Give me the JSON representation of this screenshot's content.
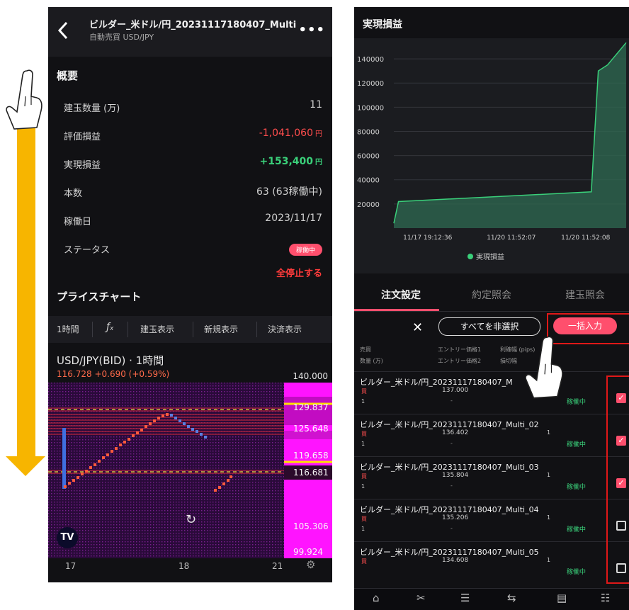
{
  "left_screen": {
    "header": {
      "title": "ビルダー_米ドル/円_20231117180407_Multi",
      "subtitle": "自動売買 USD/JPY",
      "back_icon": "chevron-left-icon",
      "more_icon": "more-dots-icon"
    },
    "summary": {
      "title": "概要",
      "rows": [
        {
          "label": "建玉数量 (万)",
          "value": "11",
          "unit": ""
        },
        {
          "label": "評価損益",
          "value": "-1,041,060",
          "unit": "円"
        },
        {
          "label": "実現損益",
          "value": "+153,400",
          "unit": "円"
        },
        {
          "label": "本数",
          "value": "63 (63稼働中)",
          "unit": ""
        },
        {
          "label": "稼働日",
          "value": "2023/11/17",
          "unit": ""
        },
        {
          "label": "ステータス",
          "value": "",
          "unit": ""
        }
      ],
      "status_badge": "稼働中",
      "stop_all": "全停止する"
    },
    "price_chart": {
      "title": "プライスチャート",
      "toolbar": [
        "1時間",
        "fx",
        "建玉表示",
        "新規表示",
        "決済表示"
      ],
      "symbol": "USD/JPY(BID) · 1時間",
      "change": "116.728 +0.690 (+0.59%)",
      "price_labels": [
        "140.000",
        "129.837",
        "125.648",
        "119.658",
        "116.681",
        "105.306",
        "99.924"
      ],
      "x_labels": [
        "17",
        "18",
        "21"
      ],
      "logo": "TV"
    }
  },
  "right_screen": {
    "title": "実現損益",
    "chart_data": {
      "type": "area",
      "title": "実現損益",
      "x": [
        "11/17 19:12:36",
        "11/20 11:52:07",
        "11/20 11:52:08"
      ],
      "y_ticks": [
        20000,
        40000,
        60000,
        80000,
        100000,
        120000,
        140000
      ],
      "series": [
        {
          "name": "実現損益",
          "points": [
            [
              0,
              4000
            ],
            [
              0.02,
              22000
            ],
            [
              0.85,
              30000
            ],
            [
              0.88,
              130000
            ],
            [
              0.92,
              135000
            ],
            [
              1.0,
              153400
            ]
          ]
        }
      ],
      "legend": "実現損益",
      "color": "#3ad07a"
    },
    "tabs": [
      "注文設定",
      "約定照会",
      "建玉照会"
    ],
    "active_tab": "注文設定",
    "actions": {
      "deselect_all": "すべてを非選択",
      "bulk_input": "一括入力"
    },
    "columns": {
      "row1": [
        "売買",
        "エントリー価格1",
        "利確幅 (pips)"
      ],
      "row2": [
        "数量 (万)",
        "エントリー価格2",
        "損切幅"
      ]
    },
    "orders": [
      {
        "name": "ビルダー_米ドル/円_20231117180407_M",
        "side": "買",
        "price": "137.000",
        "qty": "1",
        "dash": "-",
        "one": "",
        "status": "稼働中",
        "checked": true
      },
      {
        "name": "ビルダー_米ドル/円_20231117180407_Multi_02",
        "side": "買",
        "price": "136.402",
        "qty": "1",
        "dash": "-",
        "one": "1",
        "status": "稼働中",
        "checked": true
      },
      {
        "name": "ビルダー_米ドル/円_20231117180407_Multi_03",
        "side": "買",
        "price": "135.804",
        "qty": "1",
        "dash": "-",
        "one": "1",
        "status": "稼働中",
        "checked": true
      },
      {
        "name": "ビルダー_米ドル/円_20231117180407_Multi_04",
        "side": "買",
        "price": "135.206",
        "qty": "1",
        "dash": "-",
        "one": "1",
        "status": "稼働中",
        "checked": false
      },
      {
        "name": "ビルダー_米ドル/円_20231117180407_Multi_05",
        "side": "買",
        "price": "134.608",
        "qty": "",
        "dash": "",
        "one": "1",
        "status": "稼働中",
        "checked": false
      }
    ],
    "bottom_nav": [
      "home-icon",
      "tools-icon",
      "layers-icon",
      "transfer-icon",
      "chart-icon",
      "menu-icon"
    ]
  }
}
